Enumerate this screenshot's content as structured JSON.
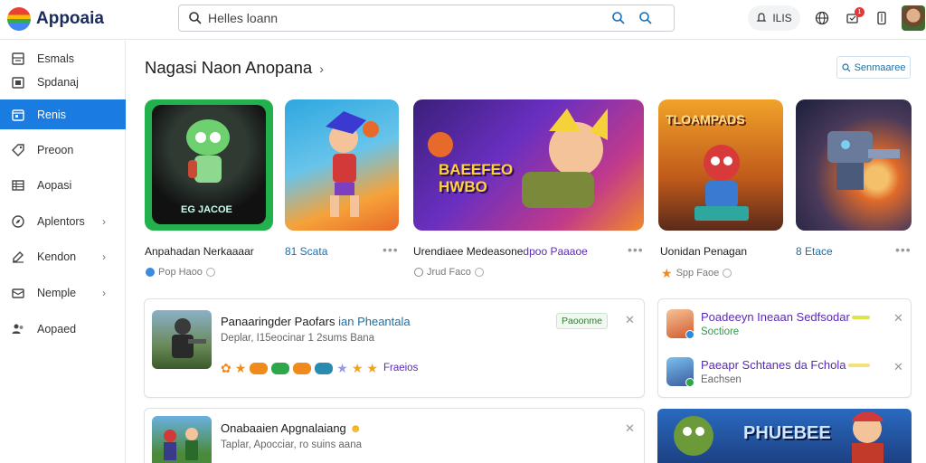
{
  "app": {
    "name": "Appoaia"
  },
  "search": {
    "placeholder": "Helles loann"
  },
  "header": {
    "pill_label": "ILIS",
    "notification_count": "1"
  },
  "sidebar": {
    "items": [
      {
        "label": "Esmals",
        "icon": "grid-icon"
      },
      {
        "label": "Spdanaj",
        "icon": "calendar-icon"
      },
      {
        "label": "Renis",
        "icon": "apps-icon",
        "active": true
      },
      {
        "label": "Preoon",
        "icon": "tag-icon"
      },
      {
        "label": "Aopasi",
        "icon": "list-icon"
      },
      {
        "label": "Aplentors",
        "icon": "compass-icon"
      },
      {
        "label": "Kendon",
        "icon": "edit-icon"
      },
      {
        "label": "Nemple",
        "icon": "mail-icon"
      },
      {
        "label": "Aopaed",
        "icon": "people-icon"
      }
    ]
  },
  "main": {
    "title": "Nagasi Naon Anopana",
    "title_suffix": "›",
    "manage_label": "Senmaaree"
  },
  "tiles": [
    {
      "name": "Anpahadan Nerkaaaar",
      "meta": "Pop Haoo",
      "art_text": "EG JACOE"
    },
    {
      "name": "81 Scata",
      "meta": "",
      "art_text": ""
    },
    {
      "name": "Urendiaee Medeasone",
      "name2": "dpoo Paaaoe",
      "meta": "Jrud Faco",
      "art_text": "BAEEFEO HWBO"
    },
    {
      "name": "Uonidan Penagan",
      "meta": "Spp Faoe",
      "art_text": "TLOAMPADS"
    },
    {
      "name": "8 Etace",
      "meta": "",
      "art_text": ""
    }
  ],
  "cards": [
    {
      "title": "Panaaringder Paofars",
      "title_accent": "ian Pheantala",
      "subtitle": "Deplar, I15eocinar 1 2sums Bana",
      "tag": "Paoonme",
      "rating_label": "Fraeios"
    },
    {
      "title": "Poadeeyn Ineaan Sedfsodar",
      "subtitle": "Soctiore"
    },
    {
      "title": "Paeapr Schtanes da Fchola",
      "subtitle": "Eachsen"
    },
    {
      "title": "Onabaaien Apgnalaiang",
      "subtitle": "Taplar, Apocciar, ro suins aana"
    },
    {
      "art_text": "PHUEBEE"
    }
  ],
  "colors": {
    "accent": "#1a7be0",
    "title_accent": "#1d6fa5",
    "purple": "#5b2bb5"
  }
}
